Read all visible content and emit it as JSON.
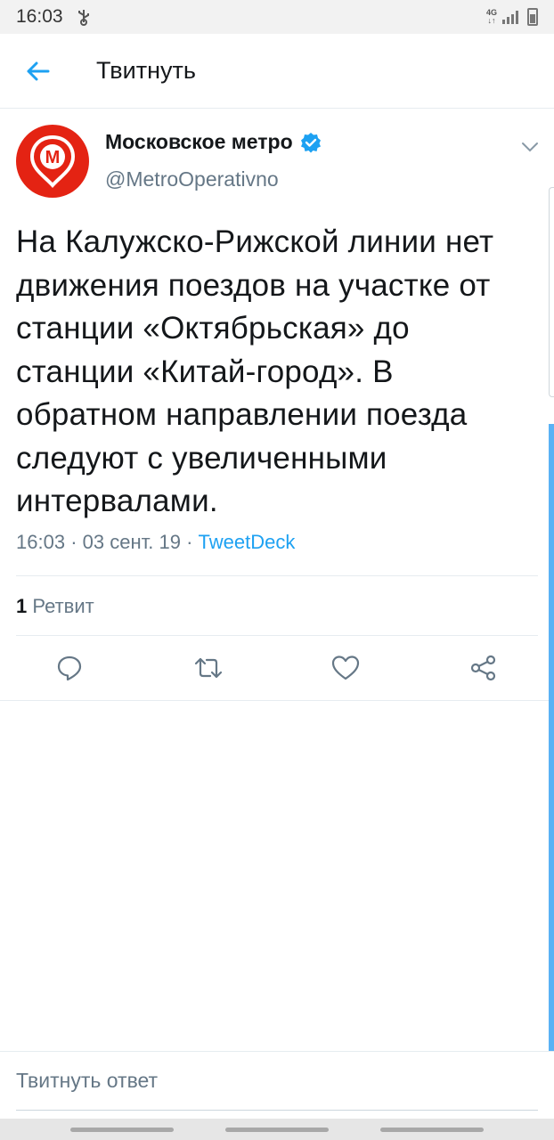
{
  "status_bar": {
    "time": "16:03",
    "network": "4G"
  },
  "header": {
    "title": "Твитнуть"
  },
  "tweet": {
    "author_name": "Московское метро",
    "author_handle": "@MetroOperativno",
    "avatar_letter": "М",
    "verified": true,
    "text": "На Калужско-Рижской линии нет движения поездов на участке от станции «Октябрьская» до станции «Китай-город». В обратном направлении поезда следуют с увеличенными интервалами.",
    "time": "16:03",
    "date": "03 сент. 19",
    "separator": "·",
    "source": "TweetDeck",
    "retweet_count": "1",
    "retweet_label": "Ретвит"
  },
  "actions": {
    "reply": "reply-icon",
    "retweet": "retweet-icon",
    "like": "heart-icon",
    "share": "share-icon"
  },
  "reply_bar": {
    "placeholder": "Твитнуть ответ"
  },
  "colors": {
    "accent": "#1da1f2",
    "metro_red": "#e42313",
    "muted_text": "#657786"
  }
}
